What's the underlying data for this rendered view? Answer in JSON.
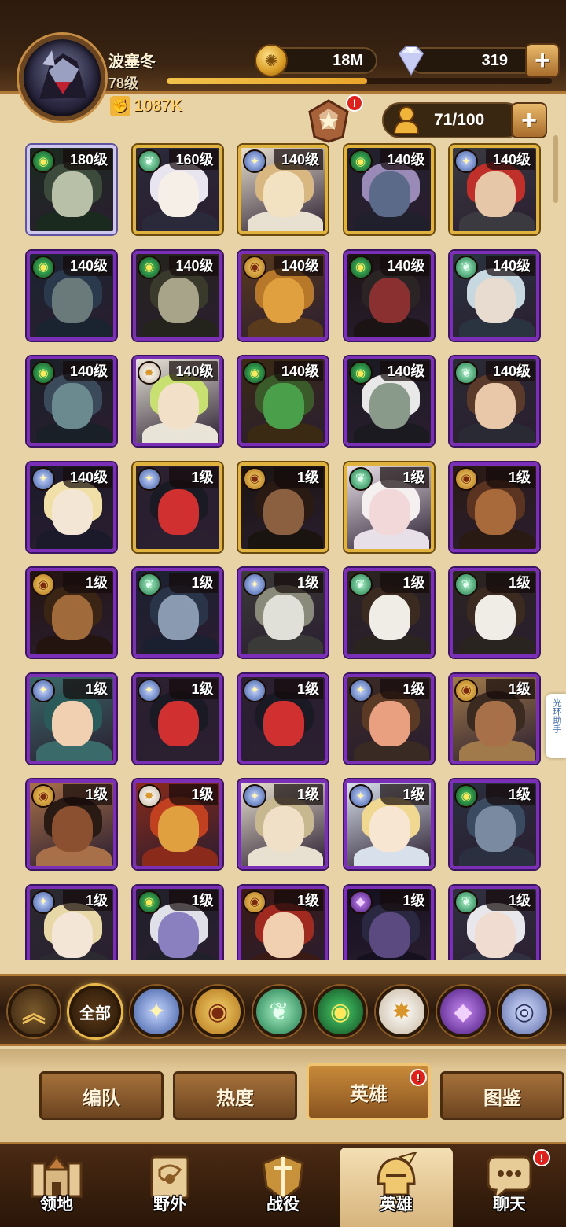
{
  "player": {
    "name": "波塞冬",
    "level": "78级",
    "power": "1087K",
    "level_progress": 0.52
  },
  "resources": {
    "gold": "18M",
    "gems": "319"
  },
  "roster": {
    "count": "71/100"
  },
  "heroes": [
    {
      "level": "180级",
      "faction": "mauler",
      "frame": "white",
      "colors": [
        "#3b4a3a",
        "#b8c0a8",
        "#1a2a1e"
      ]
    },
    {
      "level": "160级",
      "faction": "wild",
      "frame": "gold",
      "colors": [
        "#e8e4f0",
        "#f6efe8",
        "#2a2a3a"
      ]
    },
    {
      "level": "140级",
      "faction": "light",
      "frame": "gold",
      "colors": [
        "#d8b880",
        "#f2e2c2",
        "#e8e0d0"
      ]
    },
    {
      "level": "140级",
      "faction": "mauler",
      "frame": "gold",
      "colors": [
        "#9a8ab8",
        "#5c6a8a",
        "#20202c"
      ]
    },
    {
      "level": "140级",
      "faction": "light",
      "frame": "gold",
      "colors": [
        "#c0302a",
        "#e6c8a8",
        "#3a3a40"
      ]
    },
    {
      "level": "140级",
      "faction": "mauler",
      "frame": "purple",
      "colors": [
        "#2a3a4c",
        "#6a7a7a",
        "#1a2430"
      ]
    },
    {
      "level": "140级",
      "faction": "mauler",
      "frame": "purple",
      "colors": [
        "#3a3a2c",
        "#a8a48a",
        "#24241c"
      ]
    },
    {
      "level": "140级",
      "faction": "grave",
      "frame": "purple",
      "colors": [
        "#b8782a",
        "#e0a040",
        "#5a3a1c"
      ]
    },
    {
      "level": "140级",
      "faction": "mauler",
      "frame": "purple",
      "colors": [
        "#2a2424",
        "#8a3030",
        "#1a1414"
      ]
    },
    {
      "level": "140级",
      "faction": "wild",
      "frame": "purple",
      "colors": [
        "#c8d8e0",
        "#e8dcd0",
        "#2a3440"
      ]
    },
    {
      "level": "140级",
      "faction": "mauler",
      "frame": "purple",
      "colors": [
        "#3a4a5a",
        "#6a8a90",
        "#1a2028"
      ]
    },
    {
      "level": "140级",
      "faction": "celestial",
      "frame": "purple",
      "colors": [
        "#c8e070",
        "#f2e0c8",
        "#e8e4d8"
      ]
    },
    {
      "level": "140级",
      "faction": "mauler",
      "frame": "purple",
      "colors": [
        "#3a5a2a",
        "#4aa04a",
        "#3a2a14"
      ]
    },
    {
      "level": "140级",
      "faction": "mauler",
      "frame": "purple",
      "colors": [
        "#e8e8e8",
        "#8a9a8a",
        "#1a1a20"
      ]
    },
    {
      "level": "140级",
      "faction": "wild",
      "frame": "purple",
      "colors": [
        "#5a3a2a",
        "#e8c8a8",
        "#2a2a34"
      ]
    },
    {
      "level": "140级",
      "faction": "light",
      "frame": "purple",
      "colors": [
        "#f0e0a8",
        "#f4e6d4",
        "#1a1a2a"
      ]
    },
    {
      "level": "1级",
      "faction": "light",
      "frame": "gold",
      "colors": [
        "#1a1a24",
        "#d03030",
        "#2a2030"
      ]
    },
    {
      "level": "1级",
      "faction": "grave",
      "frame": "gold",
      "colors": [
        "#2a1a14",
        "#8a6040",
        "#1a1410"
      ]
    },
    {
      "level": "1级",
      "faction": "wild",
      "frame": "gold",
      "colors": [
        "#f4f0f0",
        "#f2d8d8",
        "#e8e0e8"
      ]
    },
    {
      "level": "1级",
      "faction": "grave",
      "frame": "purple",
      "colors": [
        "#5a3420",
        "#a86a3a",
        "#2a1a14"
      ]
    },
    {
      "level": "1级",
      "faction": "grave",
      "frame": "purple",
      "colors": [
        "#3a2414",
        "#a06a3a",
        "#241410"
      ]
    },
    {
      "level": "1级",
      "faction": "wild",
      "frame": "purple",
      "colors": [
        "#2a3448",
        "#8a9ab0",
        "#1a2030"
      ]
    },
    {
      "level": "1级",
      "faction": "light",
      "frame": "purple",
      "colors": [
        "#8a8a7a",
        "#e0e0d8",
        "#3a3a38"
      ]
    },
    {
      "level": "1级",
      "faction": "wild",
      "frame": "purple",
      "colors": [
        "#3a2a20",
        "#f0ece6",
        "#2a2420"
      ]
    },
    {
      "level": "1级",
      "faction": "wild",
      "frame": "purple",
      "colors": [
        "#3a2a20",
        "#f0ece6",
        "#2a2420"
      ]
    },
    {
      "level": "1级",
      "faction": "light",
      "frame": "purple",
      "colors": [
        "#2a5a5a",
        "#f0d0b0",
        "#3a6a6a"
      ]
    },
    {
      "level": "1级",
      "faction": "light",
      "frame": "purple",
      "colors": [
        "#1a1a24",
        "#d03030",
        "#2a2030"
      ]
    },
    {
      "level": "1级",
      "faction": "light",
      "frame": "purple",
      "colors": [
        "#1a1a24",
        "#d03030",
        "#2a2030"
      ]
    },
    {
      "level": "1级",
      "faction": "light",
      "frame": "purple",
      "colors": [
        "#5a3a24",
        "#e8a080",
        "#3a2a24"
      ]
    },
    {
      "level": "1级",
      "faction": "grave",
      "frame": "purple",
      "colors": [
        "#3a2a20",
        "#a87048",
        "#a07a4a"
      ]
    },
    {
      "level": "1级",
      "faction": "grave",
      "frame": "purple",
      "colors": [
        "#2a1a14",
        "#8a5030",
        "#a87048"
      ]
    },
    {
      "level": "1级",
      "faction": "celestial",
      "frame": "purple",
      "colors": [
        "#c04020",
        "#e0a040",
        "#8a2a1a"
      ]
    },
    {
      "level": "1级",
      "faction": "light",
      "frame": "purple",
      "colors": [
        "#c8b890",
        "#f0e0c8",
        "#e8e0d0"
      ]
    },
    {
      "level": "1级",
      "faction": "light",
      "frame": "purple",
      "colors": [
        "#f0d890",
        "#f6e6d2",
        "#d8e0ec"
      ]
    },
    {
      "level": "1级",
      "faction": "mauler",
      "frame": "purple",
      "colors": [
        "#3a4a60",
        "#7a8aa0",
        "#2a3040"
      ]
    },
    {
      "level": "1级",
      "faction": "light",
      "frame": "purple",
      "colors": [
        "#e8d8a8",
        "#f4e6d6",
        "#2a2a30"
      ]
    },
    {
      "level": "1级",
      "faction": "mauler",
      "frame": "purple",
      "colors": [
        "#e0e0e8",
        "#8a80c0",
        "#20202a"
      ]
    },
    {
      "level": "1级",
      "faction": "grave",
      "frame": "purple",
      "colors": [
        "#a02a20",
        "#f0d0b0",
        "#3a1a14"
      ]
    },
    {
      "level": "1级",
      "faction": "hypo",
      "frame": "purple",
      "colors": [
        "#2a2840",
        "#5a4a80",
        "#14101e"
      ]
    },
    {
      "level": "1级",
      "faction": "wild",
      "frame": "purple",
      "colors": [
        "#e8e8ec",
        "#f0dcd0",
        "#303040"
      ]
    }
  ],
  "faction_filters": [
    {
      "name": "collapse",
      "label": "︽",
      "icon": "chevron-up-icon"
    },
    {
      "name": "all",
      "label": "全部",
      "icon": "all-factions-icon"
    },
    {
      "name": "lightbearer",
      "label": "✦",
      "icon": "lightbearer-icon"
    },
    {
      "name": "graveborn",
      "label": "◉",
      "icon": "graveborn-icon"
    },
    {
      "name": "wilder",
      "label": "❦",
      "icon": "wilder-icon"
    },
    {
      "name": "mauler",
      "label": "◉",
      "icon": "mauler-eye-icon"
    },
    {
      "name": "celestial",
      "label": "✸",
      "icon": "celestial-icon"
    },
    {
      "name": "hypogean",
      "label": "◆",
      "icon": "hypogean-icon"
    },
    {
      "name": "dimensional",
      "label": "◎",
      "icon": "dimensional-icon"
    }
  ],
  "sub_tabs": [
    {
      "label": "编队",
      "active": false,
      "alert": false
    },
    {
      "label": "热度",
      "active": false,
      "alert": false
    },
    {
      "label": "英雄",
      "active": true,
      "alert": true
    },
    {
      "label": "图鉴",
      "active": false,
      "alert": false
    }
  ],
  "bottom_nav": [
    {
      "label": "领地",
      "icon": "castle-icon",
      "active": false,
      "alert": false
    },
    {
      "label": "野外",
      "icon": "map-scroll-icon",
      "active": false,
      "alert": false
    },
    {
      "label": "战役",
      "icon": "sword-shield-icon",
      "active": false,
      "alert": false
    },
    {
      "label": "英雄",
      "icon": "hero-helmet-icon",
      "active": true,
      "alert": false
    },
    {
      "label": "聊天",
      "icon": "chat-bubble-icon",
      "active": false,
      "alert": true
    }
  ],
  "helper_tab": "光环助手",
  "alert_mark": "!",
  "colors": {
    "frame_purple": "#7a2fb6",
    "frame_gold": "#e0b23e",
    "frame_white": "#cfc6f0",
    "alert_red": "#e0201a",
    "parchment": "#e8d3a6"
  }
}
